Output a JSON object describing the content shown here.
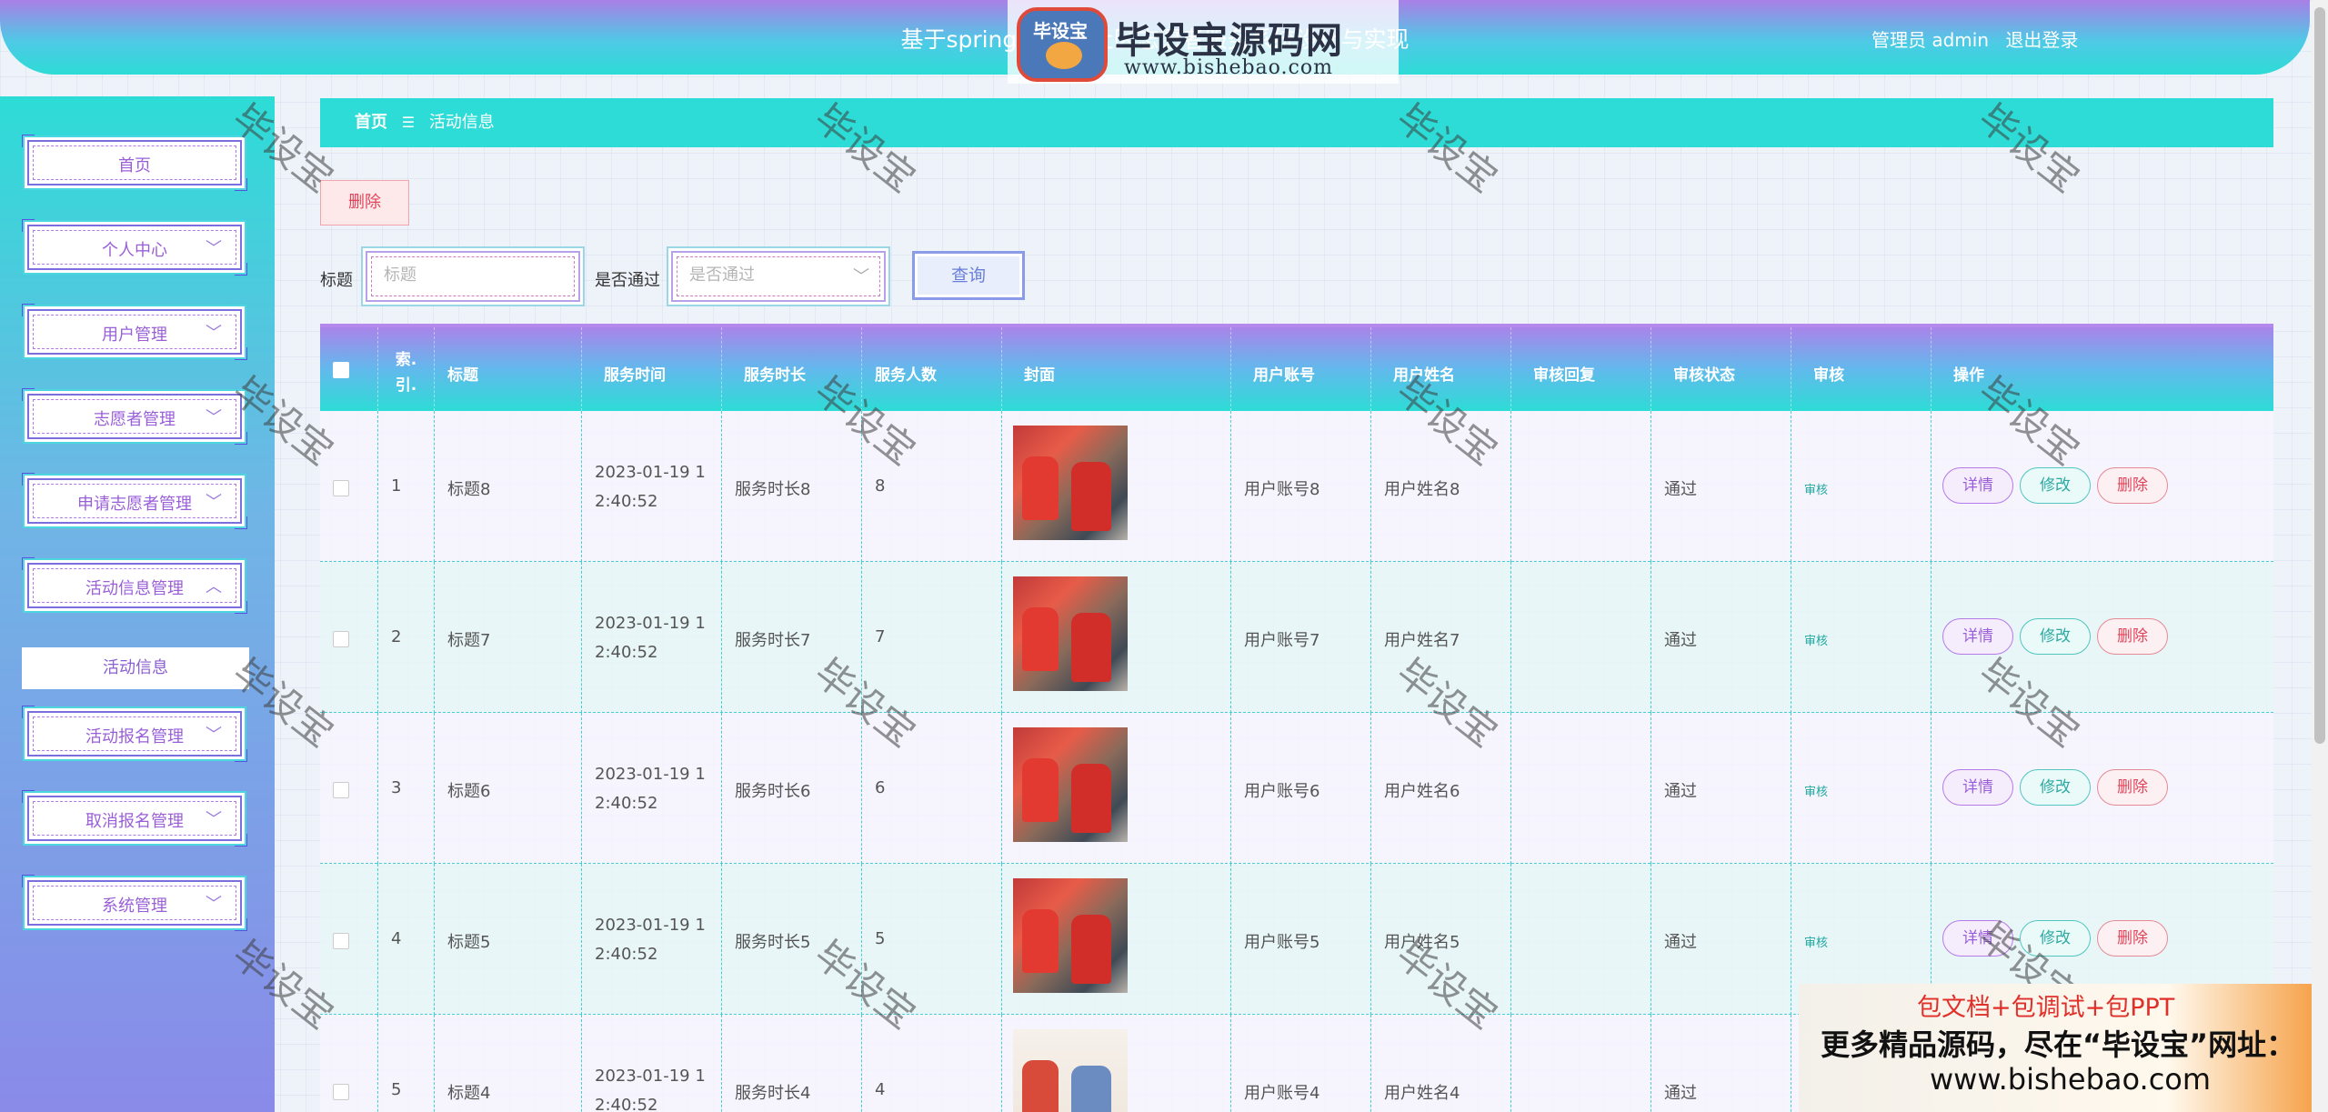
{
  "header": {
    "title": "基于springboot的社区志愿者服务系统设计与实现",
    "user_label": "管理员 admin",
    "logout_label": "退出登录"
  },
  "logo": {
    "badge_text": "毕设宝",
    "name": "毕设宝源码网",
    "url": "www.bishebao.com"
  },
  "sidebar": {
    "items": [
      {
        "label": "首页",
        "expandable": false
      },
      {
        "label": "个人中心",
        "expandable": true
      },
      {
        "label": "用户管理",
        "expandable": true
      },
      {
        "label": "志愿者管理",
        "expandable": true
      },
      {
        "label": "申请志愿者管理",
        "expandable": true
      },
      {
        "label": "活动信息管理",
        "expandable": true,
        "expanded": true
      },
      {
        "label": "活动报名管理",
        "expandable": true
      },
      {
        "label": "取消报名管理",
        "expandable": true
      },
      {
        "label": "系统管理",
        "expandable": true
      }
    ],
    "active_sub_item": "活动信息"
  },
  "breadcrumb": {
    "home": "首页",
    "separator": "☰",
    "current": "活动信息"
  },
  "toolbar": {
    "delete_label": "删除"
  },
  "filters": {
    "title_label": "标题",
    "title_placeholder": "标题",
    "approved_label": "是否通过",
    "approved_placeholder": "是否通过",
    "query_label": "查询"
  },
  "table": {
    "columns": [
      "",
      "索引",
      "标题",
      "服务时间",
      "服务时长",
      "服务人数",
      "封面",
      "用户账号",
      "用户姓名",
      "审核回复",
      "审核状态",
      "审核",
      "操作"
    ],
    "rows": [
      {
        "index": "1",
        "title": "标题8",
        "time_line1": "2023-01-19 1",
        "time_line2": "2:40:52",
        "duration": "服务时长8",
        "people": "8",
        "account": "用户账号8",
        "name": "用户姓名8",
        "reply": "",
        "status": "通过",
        "audit": "审核"
      },
      {
        "index": "2",
        "title": "标题7",
        "time_line1": "2023-01-19 1",
        "time_line2": "2:40:52",
        "duration": "服务时长7",
        "people": "7",
        "account": "用户账号7",
        "name": "用户姓名7",
        "reply": "",
        "status": "通过",
        "audit": "审核"
      },
      {
        "index": "3",
        "title": "标题6",
        "time_line1": "2023-01-19 1",
        "time_line2": "2:40:52",
        "duration": "服务时长6",
        "people": "6",
        "account": "用户账号6",
        "name": "用户姓名6",
        "reply": "",
        "status": "通过",
        "audit": "审核"
      },
      {
        "index": "4",
        "title": "标题5",
        "time_line1": "2023-01-19 1",
        "time_line2": "2:40:52",
        "duration": "服务时长5",
        "people": "5",
        "account": "用户账号5",
        "name": "用户姓名5",
        "reply": "",
        "status": "通过",
        "audit": "审核"
      },
      {
        "index": "5",
        "title": "标题4",
        "time_line1": "2023-01-19 1",
        "time_line2": "2:40:52",
        "duration": "服务时长4",
        "people": "4",
        "account": "用户账号4",
        "name": "用户姓名4",
        "reply": "",
        "status": "通过",
        "audit": "审核"
      }
    ],
    "actions": {
      "detail": "详情",
      "edit": "修改",
      "delete": "删除"
    }
  },
  "watermark": "毕设宝",
  "ad": {
    "line1": "包文档+包调试+包PPT",
    "line2": "更多精品源码，尽在“毕设宝”网址：",
    "line3": "www.bishebao.com"
  }
}
